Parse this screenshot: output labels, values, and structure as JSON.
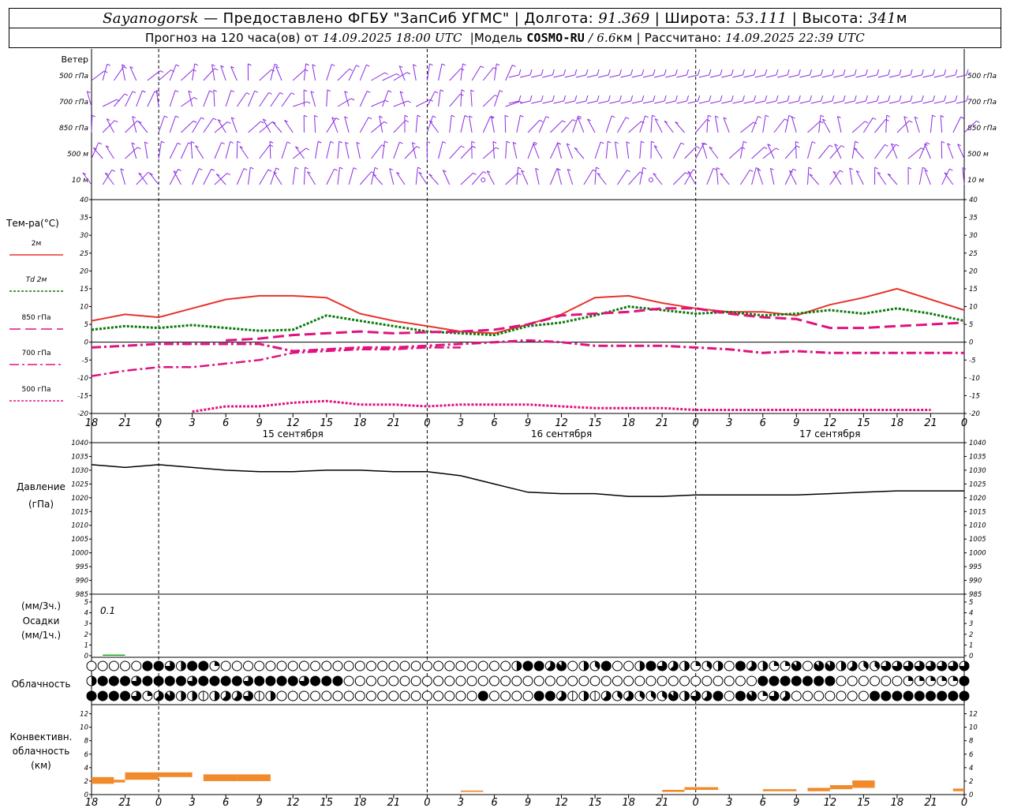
{
  "header": {
    "station": "Sayanogorsk",
    "provider": "— Предоставлено ФГБУ \"ЗапСиб УГМС\"",
    "sep": "|",
    "lon_label": "Долгота:",
    "lon_value": "91.369",
    "lat_label": "Широта:",
    "lat_value": "53.111",
    "alt_label": "Высота:",
    "alt_value": "341",
    "alt_unit": "м",
    "forecast_label": "Прогноз на 120 часа(ов) от",
    "forecast_start": "14.09.2025 18:00 UTC",
    "model_label": "Модель",
    "model_name": "COSMO-RU",
    "model_res": "/ 6.6",
    "model_res_unit": "км",
    "computed_label": "Рассчитано:",
    "computed_value": "14.09.2025 22:39 UTC"
  },
  "colors": {
    "wind": "#8a2be2",
    "t2m": "#e8332c",
    "td2m": "#0a7a0a",
    "t850": "#e0127f",
    "t700": "#e0127f",
    "t500": "#e0127f",
    "pressure": "#000000",
    "precip": "#00a000",
    "convective": "#f08a2a"
  },
  "chart_data": [
    {
      "type": "barbs",
      "name": "wind",
      "panel_label": "Ветер",
      "levels": [
        "500 гПа",
        "700 гПа",
        "850 гПа",
        "500 м",
        "10 м"
      ],
      "note": "wind barbs by level"
    },
    {
      "type": "line",
      "name": "temperature",
      "ylabel": "Тем-ра(°C)",
      "ylim": [
        -20,
        40
      ],
      "yticks": [
        -20,
        -15,
        -10,
        -5,
        0,
        5,
        10,
        15,
        20,
        25,
        30,
        35,
        40
      ],
      "x_hours": [
        0,
        3,
        6,
        9,
        12,
        15,
        18,
        21,
        24,
        27,
        30,
        33,
        36,
        39,
        42,
        45,
        48,
        51,
        54,
        57,
        60,
        63,
        66,
        69,
        72,
        75,
        78
      ],
      "x_tick_labels": [
        "18",
        "21",
        "0",
        "3",
        "6",
        "9",
        "12",
        "15",
        "18",
        "21",
        "0",
        "3",
        "6",
        "9",
        "12",
        "15",
        "18",
        "21",
        "0",
        "3",
        "6",
        "9",
        "12",
        "15",
        "18",
        "21",
        "0"
      ],
      "day_labels": [
        "15 сентября",
        "16 сентября",
        "17 сентября"
      ],
      "series": [
        {
          "name": "2м",
          "style": "solid",
          "values": [
            6,
            7.8,
            7,
            9.5,
            12,
            13,
            13,
            12.5,
            8,
            6,
            4.5,
            3,
            2.5,
            5,
            7.8,
            12.5,
            13,
            11,
            9.5,
            8.5,
            8.5,
            7.5,
            10.5,
            12.5,
            15,
            12,
            9
          ]
        },
        {
          "name": "Td 2м",
          "style": "dotted",
          "values": [
            3.5,
            4.5,
            4,
            4.8,
            4,
            3.2,
            3.5,
            7.5,
            6,
            4.5,
            3,
            2.5,
            2,
            4.5,
            5.5,
            7.5,
            10,
            9,
            8,
            8.5,
            7.5,
            8,
            9,
            8,
            9.5,
            8,
            6
          ]
        },
        {
          "name": "850 гПа",
          "style": "dashed",
          "values": [
            null,
            null,
            null,
            null,
            0.5,
            1,
            2,
            2.5,
            3,
            2.5,
            2.8,
            3,
            3.5,
            5,
            7.5,
            8,
            8.5,
            9.5,
            9.5,
            8,
            7,
            6.5,
            4,
            4,
            4.5,
            5,
            5.5
          ]
        },
        {
          "name": "700 гПа",
          "style": "dashdot",
          "values": [
            -1.5,
            -1,
            -0.5,
            -0.5,
            -0.5,
            -0.5,
            -2.5,
            -2,
            -1.5,
            -1.5,
            -1,
            -0.5,
            0,
            0.5,
            0,
            -1,
            -1,
            -1,
            -1.5,
            -2,
            -3,
            -2.5,
            -3,
            -3,
            -3,
            -3,
            -3
          ]
        },
        {
          "name": "500 гПа",
          "style": "dotted",
          "values": [
            null,
            null,
            null,
            -19.5,
            -18,
            -18,
            -17,
            -16.5,
            -17.5,
            -17.5,
            -18,
            -17.5,
            -17.5,
            -17.5,
            -18,
            -18.5,
            -18.5,
            -18.5,
            -19,
            -19,
            -19,
            -19,
            -19,
            -19,
            -19,
            -19,
            null
          ]
        },
        {
          "name": "500 гПа (low)",
          "style": "dashdot",
          "values": [
            -9.5,
            -8,
            -7,
            -7,
            -6,
            -5,
            -3,
            -2.5,
            -2,
            -2,
            -1.5,
            -1.5,
            null,
            null,
            null,
            null,
            null,
            null,
            null,
            null,
            null,
            null,
            null,
            null,
            null,
            null,
            null
          ]
        }
      ]
    },
    {
      "type": "line",
      "name": "pressure",
      "ylabel": "Давление",
      "yunit": "(гПа)",
      "ylim": [
        985,
        1040
      ],
      "yticks": [
        985,
        990,
        995,
        1000,
        1005,
        1010,
        1015,
        1020,
        1025,
        1030,
        1035,
        1040
      ],
      "series": [
        {
          "name": "pressure",
          "values": [
            1032,
            1031,
            1032,
            1031,
            1030,
            1029.5,
            1029.5,
            1030,
            1030,
            1029.5,
            1029.5,
            1028,
            1025,
            1022,
            1021.5,
            1021.5,
            1020.5,
            1020.5,
            1021,
            1021,
            1021,
            1021,
            1021.5,
            1022,
            1022.5,
            1022.5,
            1022.5
          ]
        }
      ]
    },
    {
      "type": "bar",
      "name": "precipitation",
      "ylabel_top": "(мм/3ч.)",
      "ylabel_mid": "Осадки",
      "ylabel_bot": "(мм/1ч.)",
      "ylim": [
        0,
        5
      ],
      "yticks": [
        0,
        1,
        2,
        3,
        4,
        5
      ],
      "annotation": "0.1",
      "values": [
        0.1
      ]
    },
    {
      "type": "table",
      "name": "cloudiness",
      "label": "Облачность",
      "rows": 3,
      "note": "octa symbols per hour, 3 layers"
    },
    {
      "type": "bar",
      "name": "convective",
      "ylabel": [
        "Конвективн.",
        "облачность",
        "(км)"
      ],
      "ylim": [
        0,
        13
      ],
      "yticks": [
        0,
        2,
        4,
        6,
        8,
        10,
        12
      ],
      "segments": [
        {
          "x0": 0,
          "x1": 2,
          "lo": 1.6,
          "hi": 2.6
        },
        {
          "x0": 2,
          "x1": 3,
          "lo": 1.8,
          "hi": 2.2
        },
        {
          "x0": 3,
          "x1": 6,
          "lo": 2.2,
          "hi": 3.3
        },
        {
          "x0": 6,
          "x1": 9,
          "lo": 2.6,
          "hi": 3.3
        },
        {
          "x0": 10,
          "x1": 13,
          "lo": 2.0,
          "hi": 3.0
        },
        {
          "x0": 13,
          "x1": 16,
          "lo": 2.0,
          "hi": 3.0
        },
        {
          "x0": 33,
          "x1": 35,
          "lo": 0.4,
          "hi": 0.6
        },
        {
          "x0": 51,
          "x1": 53,
          "lo": 0.4,
          "hi": 0.7
        },
        {
          "x0": 53,
          "x1": 56,
          "lo": 0.7,
          "hi": 1.1
        },
        {
          "x0": 60,
          "x1": 63,
          "lo": 0.5,
          "hi": 0.8
        },
        {
          "x0": 64,
          "x1": 66,
          "lo": 0.5,
          "hi": 1.0
        },
        {
          "x0": 66,
          "x1": 68,
          "lo": 0.8,
          "hi": 1.4
        },
        {
          "x0": 68,
          "x1": 70,
          "lo": 1.0,
          "hi": 2.1
        },
        {
          "x0": 77,
          "x1": 78,
          "lo": 0.5,
          "hi": 0.9
        }
      ]
    }
  ]
}
